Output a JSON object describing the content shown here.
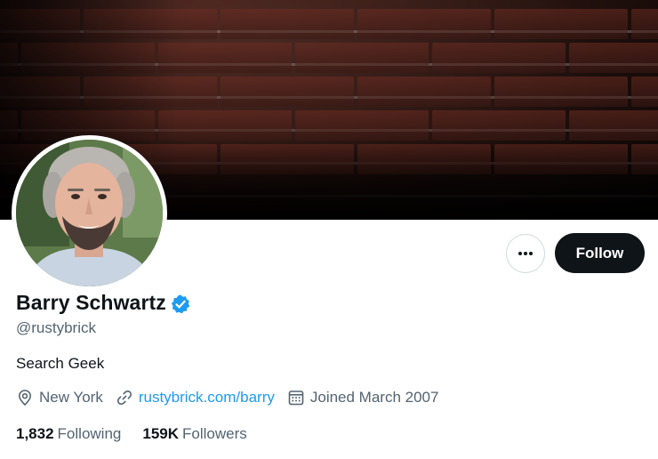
{
  "profile": {
    "name": "Barry Schwartz",
    "handle": "@rustybrick",
    "bio": "Search Geek",
    "location": "New York",
    "website": "rustybrick.com/barry",
    "joined": "Joined March 2007",
    "following_count": "1,832",
    "following_label": "Following",
    "followers_count": "159K",
    "followers_label": "Followers"
  },
  "actions": {
    "follow_label": "Follow",
    "more_icon": "ellipsis-icon"
  },
  "icons": {
    "verified": "verified-badge-icon",
    "location": "location-pin-icon",
    "website": "link-icon",
    "joined": "calendar-icon"
  },
  "colors": {
    "accent": "#1d9bf0",
    "text_primary": "#0f1419",
    "text_secondary": "#536471",
    "follow_bg": "#0f1419"
  }
}
